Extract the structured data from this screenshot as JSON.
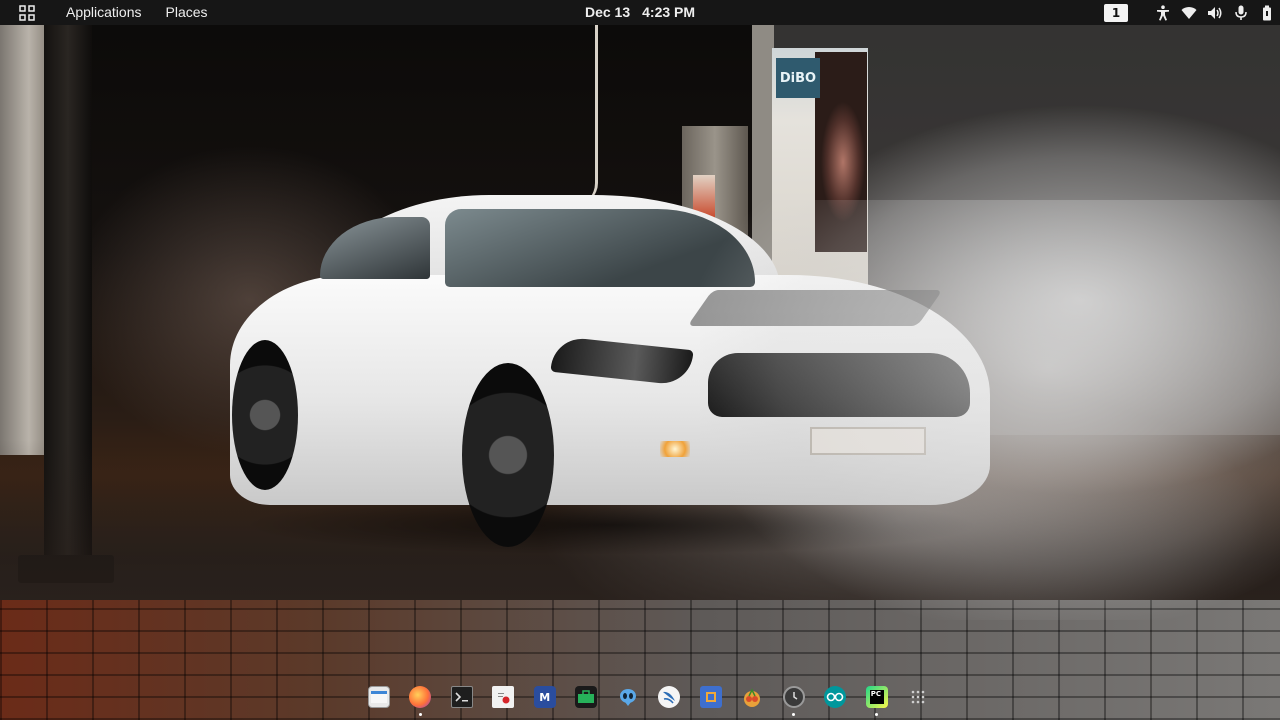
{
  "topbar": {
    "activities_icon": "app-grid-icon",
    "applications_label": "Applications",
    "places_label": "Places",
    "clock": {
      "date": "Dec 13",
      "time": "4:23 PM"
    },
    "workspace_number": "1",
    "status_icons": [
      "accessibility-icon",
      "wifi-icon",
      "volume-icon",
      "microphone-icon",
      "battery-icon"
    ]
  },
  "wallpaper": {
    "poster_logo_text": "DiBO"
  },
  "dock": {
    "items": [
      {
        "name": "files",
        "icon": "files-icon",
        "color": "#e9e9e9",
        "running": false
      },
      {
        "name": "firefox",
        "icon": "firefox-icon",
        "color": "#ff7139",
        "running": true
      },
      {
        "name": "terminal",
        "icon": "terminal-icon",
        "color": "#1e1e1e",
        "running": false
      },
      {
        "name": "text-editor",
        "icon": "text-editor-icon",
        "color": "#f2f2f2",
        "running": false
      },
      {
        "name": "metasploit",
        "icon": "metasploit-icon",
        "color": "#2a4d9e",
        "running": false
      },
      {
        "name": "maltego",
        "icon": "maltego-icon",
        "color": "#27b15a",
        "running": false
      },
      {
        "name": "alien-app",
        "icon": "alien-icon",
        "color": "#3b7bd8",
        "running": false
      },
      {
        "name": "kali-bird",
        "icon": "kali-dragon-icon",
        "color": "#2d6db5",
        "running": false
      },
      {
        "name": "burpsuite",
        "icon": "burpsuite-icon",
        "color": "#3e6fce",
        "running": false
      },
      {
        "name": "cherrytree",
        "icon": "cherrytree-icon",
        "color": "#d94b2a",
        "running": false
      },
      {
        "name": "clock-app",
        "icon": "clock-icon",
        "color": "#3a3a3a",
        "running": true
      },
      {
        "name": "arduino",
        "icon": "arduino-icon",
        "color": "#00979c",
        "running": false
      },
      {
        "name": "pycharm",
        "icon": "pycharm-icon",
        "color": "#21d789",
        "running": true
      },
      {
        "name": "show-apps",
        "icon": "show-apps-grid-icon",
        "color": "#cccccc",
        "running": false
      }
    ]
  }
}
